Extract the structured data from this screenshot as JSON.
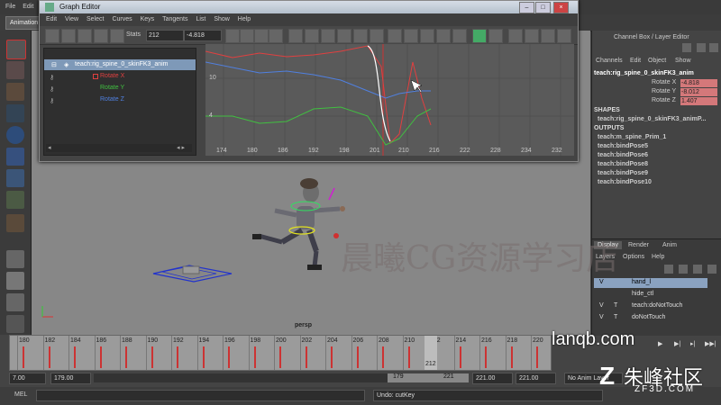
{
  "main_menu": [
    "File",
    "Edit"
  ],
  "mode": "Animation",
  "graph_editor": {
    "title": "Graph Editor",
    "menu": [
      "Edit",
      "View",
      "Select",
      "Curves",
      "Keys",
      "Tangents",
      "List",
      "Show",
      "Help"
    ],
    "stats_label": "Stats",
    "stats_frame": "212",
    "stats_value": "-4.818",
    "node": "teach:rig_spine_0_skinFK3_anim",
    "channels": [
      "Rotate X",
      "Rotate Y",
      "Rotate Z"
    ],
    "y_labels": [
      "10",
      "4"
    ],
    "x_labels": [
      "174",
      "180",
      "186",
      "192",
      "198",
      "201",
      "210",
      "216",
      "222",
      "228",
      "234",
      "232"
    ],
    "curve_colors": {
      "rotate_x": "#e04040",
      "rotate_y": "#40c040",
      "rotate_z": "#5080e0"
    }
  },
  "viewport": {
    "camera": "persp"
  },
  "channel_box": {
    "menu": [
      "Channels",
      "Edit",
      "Object",
      "Show"
    ],
    "title": "Channel Box / Layer Editor",
    "node": "teach:rig_spine_0_skinFK3_anim",
    "attrs": [
      {
        "label": "Rotate X",
        "value": "-4.818"
      },
      {
        "label": "Rotate Y",
        "value": "-8.012"
      },
      {
        "label": "Rotate Z",
        "value": "1.407"
      }
    ],
    "shapes_heading": "SHAPES",
    "shapes": [
      "teach:rig_spine_0_skinFK3_animP..."
    ],
    "outputs_heading": "OUTPUTS",
    "outputs": [
      "teach:m_spine_Prim_1",
      "teach:bindPose5",
      "teach:bindPose6",
      "teach:bindPose8",
      "teach:bindPose9",
      "teach:bindPose10"
    ]
  },
  "layer_editor": {
    "tabs": [
      "Display",
      "Render",
      "Anim"
    ],
    "menu": [
      "Layers",
      "Options",
      "Help"
    ],
    "layers": [
      {
        "v": "V",
        "t": "",
        "name": "hand_l"
      },
      {
        "v": "",
        "t": "",
        "name": "hide_ctl"
      },
      {
        "v": "V",
        "t": "T",
        "name": "teach:doNotTouch"
      },
      {
        "v": "V",
        "t": "T",
        "name": "doNotTouch"
      }
    ]
  },
  "time_slider": {
    "ticks": [
      "180",
      "182",
      "184",
      "186",
      "188",
      "190",
      "192",
      "194",
      "196",
      "198",
      "200",
      "202",
      "204",
      "206",
      "208",
      "210",
      "212",
      "214",
      "216",
      "218",
      "220"
    ],
    "current": "212"
  },
  "range_bar": {
    "start": "7.00",
    "min": "179.00",
    "inner_start": "179",
    "inner_end": "221",
    "end": "221.00",
    "max": "221.00",
    "anim_layer": "No Anim Layer"
  },
  "command_line": {
    "label": "MEL",
    "feedback": "Undo: cutKey"
  },
  "watermarks": {
    "cn": "晨曦CG资源学习店",
    "url": "lanqb.com",
    "brand": "朱峰社区",
    "brand_sub": "ZF3D.COM"
  }
}
